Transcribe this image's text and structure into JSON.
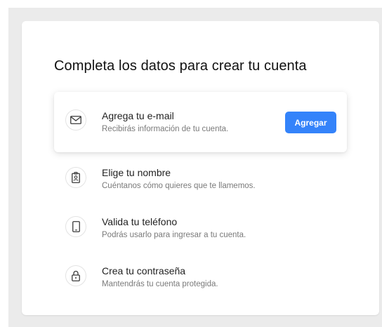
{
  "card": {
    "title": "Completa los datos para crear tu cuenta"
  },
  "steps": [
    {
      "icon": "mail-icon",
      "title": "Agrega tu e-mail",
      "subtitle": "Recibirás información de tu cuenta.",
      "button_label": "Agregar",
      "active": true
    },
    {
      "icon": "id-badge-icon",
      "title": "Elige tu nombre",
      "subtitle": "Cuéntanos cómo quieres que te llamemos.",
      "active": false
    },
    {
      "icon": "phone-icon",
      "title": "Valida tu teléfono",
      "subtitle": "Podrás usarlo para ingresar a tu cuenta.",
      "active": false
    },
    {
      "icon": "lock-icon",
      "title": "Crea tu contraseña",
      "subtitle": "Mantendrás tu cuenta protegida.",
      "active": false
    }
  ],
  "colors": {
    "accent": "#3483fa",
    "background": "#ebebeb",
    "icon_stroke": "#3a3a3a"
  }
}
